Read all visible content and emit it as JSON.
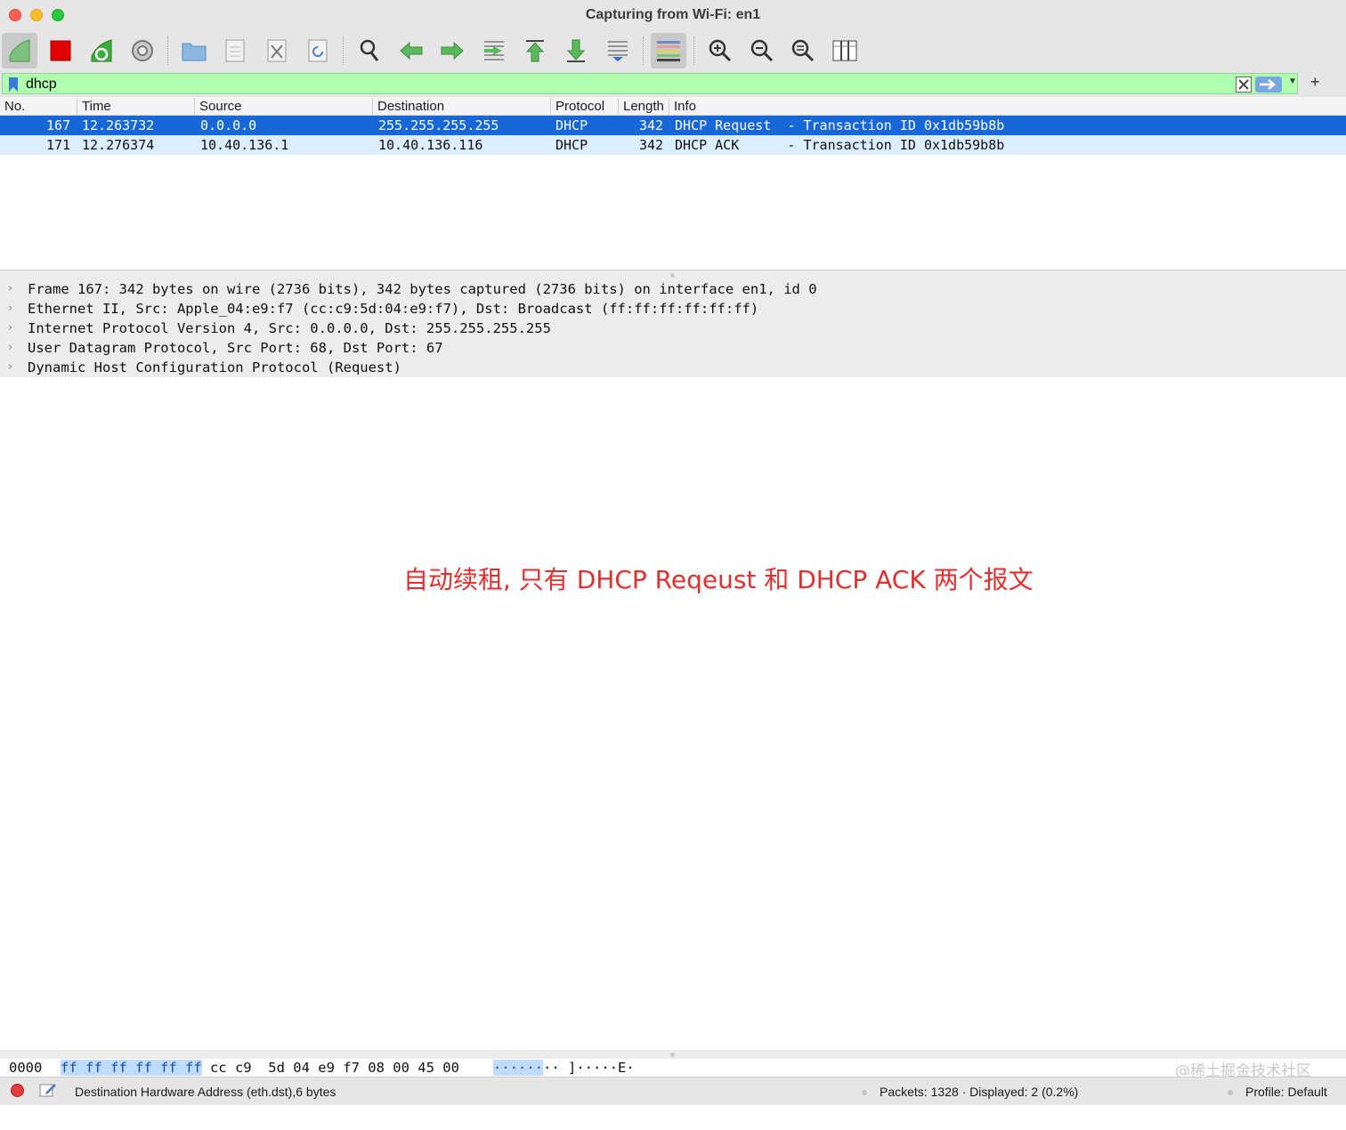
{
  "window": {
    "title": "Capturing from Wi-Fi: en1"
  },
  "toolbar": {
    "buttons": [
      "start-capture-icon",
      "stop-capture-icon",
      "restart-capture-icon",
      "capture-options-icon",
      "open-file-icon",
      "save-file-icon",
      "close-file-icon",
      "reload-file-icon",
      "find-packet-icon",
      "go-back-icon",
      "go-forward-icon",
      "go-to-packet-icon",
      "first-packet-icon",
      "last-packet-icon",
      "auto-scroll-icon",
      "colorize-icon",
      "zoom-in-icon",
      "zoom-out-icon",
      "normal-size-icon",
      "resize-columns-icon"
    ]
  },
  "filter": {
    "value": "dhcp"
  },
  "packet_list": {
    "columns": [
      "No.",
      "Time",
      "Source",
      "Destination",
      "Protocol",
      "Length",
      "Info"
    ],
    "rows": [
      {
        "no": "167",
        "time": "12.263732",
        "source": "0.0.0.0",
        "destination": "255.255.255.255",
        "protocol": "DHCP",
        "length": "342",
        "info": "DHCP Request  - Transaction ID 0x1db59b8b"
      },
      {
        "no": "171",
        "time": "12.276374",
        "source": "10.40.136.1",
        "destination": "10.40.136.116",
        "protocol": "DHCP",
        "length": "342",
        "info": "DHCP ACK      - Transaction ID 0x1db59b8b"
      }
    ]
  },
  "details": [
    "Frame 167: 342 bytes on wire (2736 bits), 342 bytes captured (2736 bits) on interface en1, id 0",
    "Ethernet II, Src: Apple_04:e9:f7 (cc:c9:5d:04:e9:f7), Dst: Broadcast (ff:ff:ff:ff:ff:ff)",
    "Internet Protocol Version 4, Src: 0.0.0.0, Dst: 255.255.255.255",
    "User Datagram Protocol, Src Port: 68, Dst Port: 67",
    "Dynamic Host Configuration Protocol (Request)"
  ],
  "annotation": "自动续租, 只有 DHCP Reqeust 和 DHCP ACK 两个报文",
  "bytes": {
    "offset": "0000",
    "hex_highlight": "ff ff ff ff ff ff",
    "hex_rest": " cc c9  5d 04 e9 f7 08 00 45 00",
    "ascii_highlight": "······",
    "ascii_rest": "·· ]·····E·"
  },
  "watermark": "@稀土掘金技术社区",
  "status": {
    "field": "Destination Hardware Address (eth.dst),6 bytes",
    "packets": "Packets: 1328 · Displayed: 2 (0.2%)",
    "profile": "Profile: Default"
  },
  "colors": {
    "filter_ok": "#afffaf",
    "selected_row": "#1767d8",
    "alt_row": "#daeeff",
    "annotation": "#e0302e"
  }
}
